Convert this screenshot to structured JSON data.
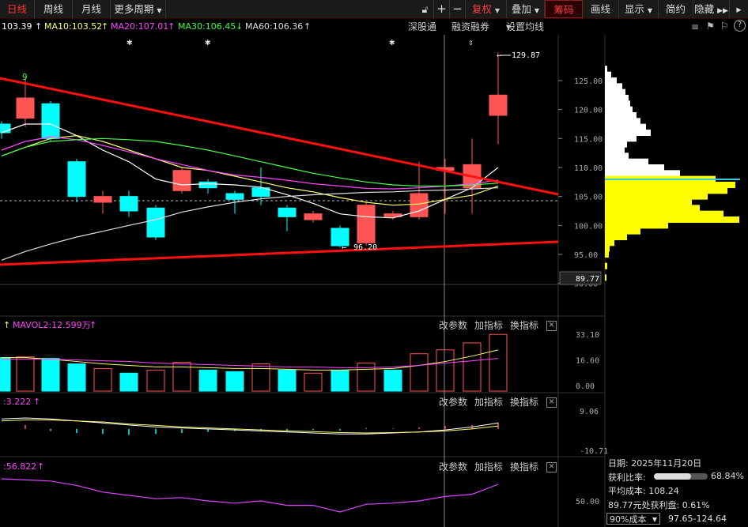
{
  "toolbar": {
    "day": "日线",
    "week": "周线",
    "month": "月线",
    "more": "更多周期",
    "fuquan": "复权",
    "diejia": "叠加",
    "chouma": "筹码",
    "huaxian": "画线",
    "xianshi": "显示",
    "jianyue": "简约",
    "yincang": "隐藏"
  },
  "ma_legend": {
    "ma5": "103.39",
    "ma10": "MA10:103.52",
    "ma20": "MA20:107.01",
    "ma30": "MA30:106.45",
    "ma60": "MA60:106.36",
    "sgt": "深股通",
    "rzrq": "融资融券",
    "setma": "设置均线"
  },
  "price_axis": [
    "125.00",
    "120.00",
    "115.00",
    "110.00",
    "105.00",
    "100.00",
    "95.00",
    "90.00"
  ],
  "current_price": "89.77",
  "annotations": {
    "high": "129.87",
    "low": "96.20",
    "nine": "9"
  },
  "volume_panel": {
    "label": "MAVOL2:12.599万",
    "axis": [
      "33.10",
      "16.60",
      "0.00"
    ],
    "btn1": "改参数",
    "btn2": "加指标",
    "btn3": "换指标"
  },
  "macd_panel": {
    "label": ":3.222",
    "axis": [
      "9.06",
      "-10.71"
    ],
    "btn1": "改参数",
    "btn2": "加指标",
    "btn3": "换指标"
  },
  "rsi_panel": {
    "label": ":56.822",
    "axis": [
      "50.00"
    ],
    "btn1": "改参数",
    "btn2": "加指标",
    "btn3": "换指标"
  },
  "chip_info": {
    "date": "日期: 2025年11月20日",
    "profit_ratio_label": "获利比率:",
    "profit_ratio": "68.84%",
    "profit_ratio_fraction": 0.6884,
    "avg_cost": "平均成本: 108.24",
    "price_profit": "89.77元处获利盘: 0.61%",
    "cost_select": "90%成本",
    "cost_range": "97.65-124.64"
  },
  "colors": {
    "up": "#ff5555",
    "down": "#00ffff",
    "trend": "#ff1010",
    "chip_profit": "#ffffff",
    "chip_loss": "#ffff00"
  }
}
